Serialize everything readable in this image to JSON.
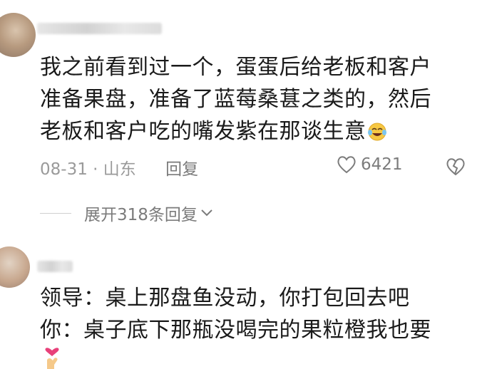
{
  "comments": [
    {
      "lines": [
        "我之前看到过一个，蛋蛋后给老板和客户",
        "准备果盘，准备了蓝莓桑葚之类的，然后",
        "老板和客户吃的嘴发紫在那谈生意"
      ],
      "emoji_icon": "laughing-crying-face-icon",
      "date": "08-31",
      "separator": "·",
      "location": "山东",
      "reply_label": "回复",
      "likes": "6421",
      "expand_label": "展开318条回复"
    },
    {
      "lines": [
        "领导：桌上那盘鱼没动，你打包回去吧",
        "你：桌子底下那瓶没喝完的果粒橙我也要"
      ],
      "sticker_icon": "heart-hand-icon"
    }
  ],
  "colors": {
    "text": "#1a1a1a",
    "meta": "#9a9a9a",
    "background": "#ffffff"
  }
}
